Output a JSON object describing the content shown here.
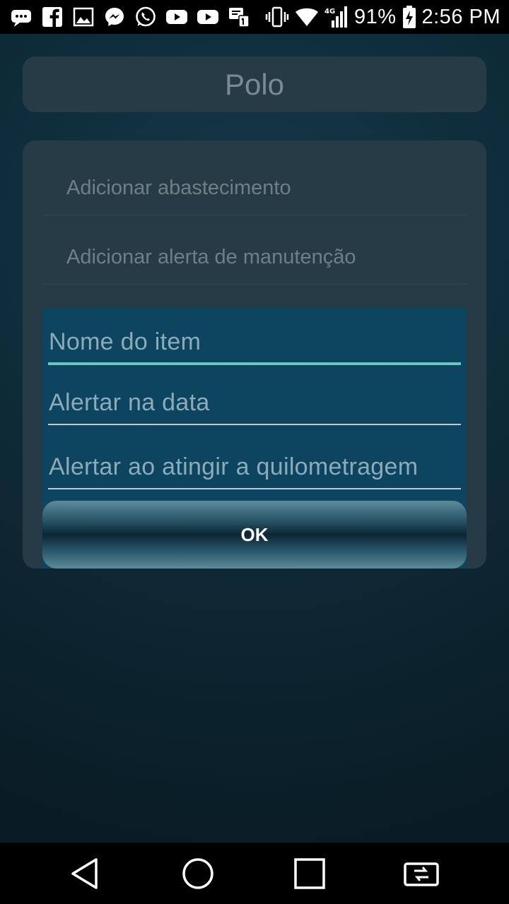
{
  "status_bar": {
    "notification_icons": [
      "messages-icon",
      "facebook-icon",
      "gallery-icon",
      "messenger-icon",
      "whatsapp-icon",
      "youtube-icon",
      "youtube-icon",
      "sim-toolkit-icon"
    ],
    "system_icons": [
      "vibrate-icon",
      "wifi-icon",
      "signal-4g-icon",
      "battery-charging-icon"
    ],
    "network_label": "4G",
    "battery": "91%",
    "time": "2:56 PM"
  },
  "header": {
    "title": "Polo"
  },
  "menu": {
    "items": [
      {
        "label": "Adicionar abastecimento"
      },
      {
        "label": "Adicionar alerta de manutenção"
      }
    ]
  },
  "dialog": {
    "fields": [
      {
        "placeholder": "Nome do item",
        "value": ""
      },
      {
        "placeholder": "Alertar na data",
        "value": ""
      },
      {
        "placeholder": "Alertar ao atingir a quilometragem",
        "value": ""
      }
    ],
    "ok_label": "OK"
  },
  "nav_bar": {
    "buttons": [
      "back-icon",
      "home-icon",
      "recents-icon",
      "switch-app-icon"
    ]
  },
  "colors": {
    "dialog_bg": "#0d4560",
    "focused_underline": "#69c7c0",
    "card_bg": "#263b45"
  }
}
